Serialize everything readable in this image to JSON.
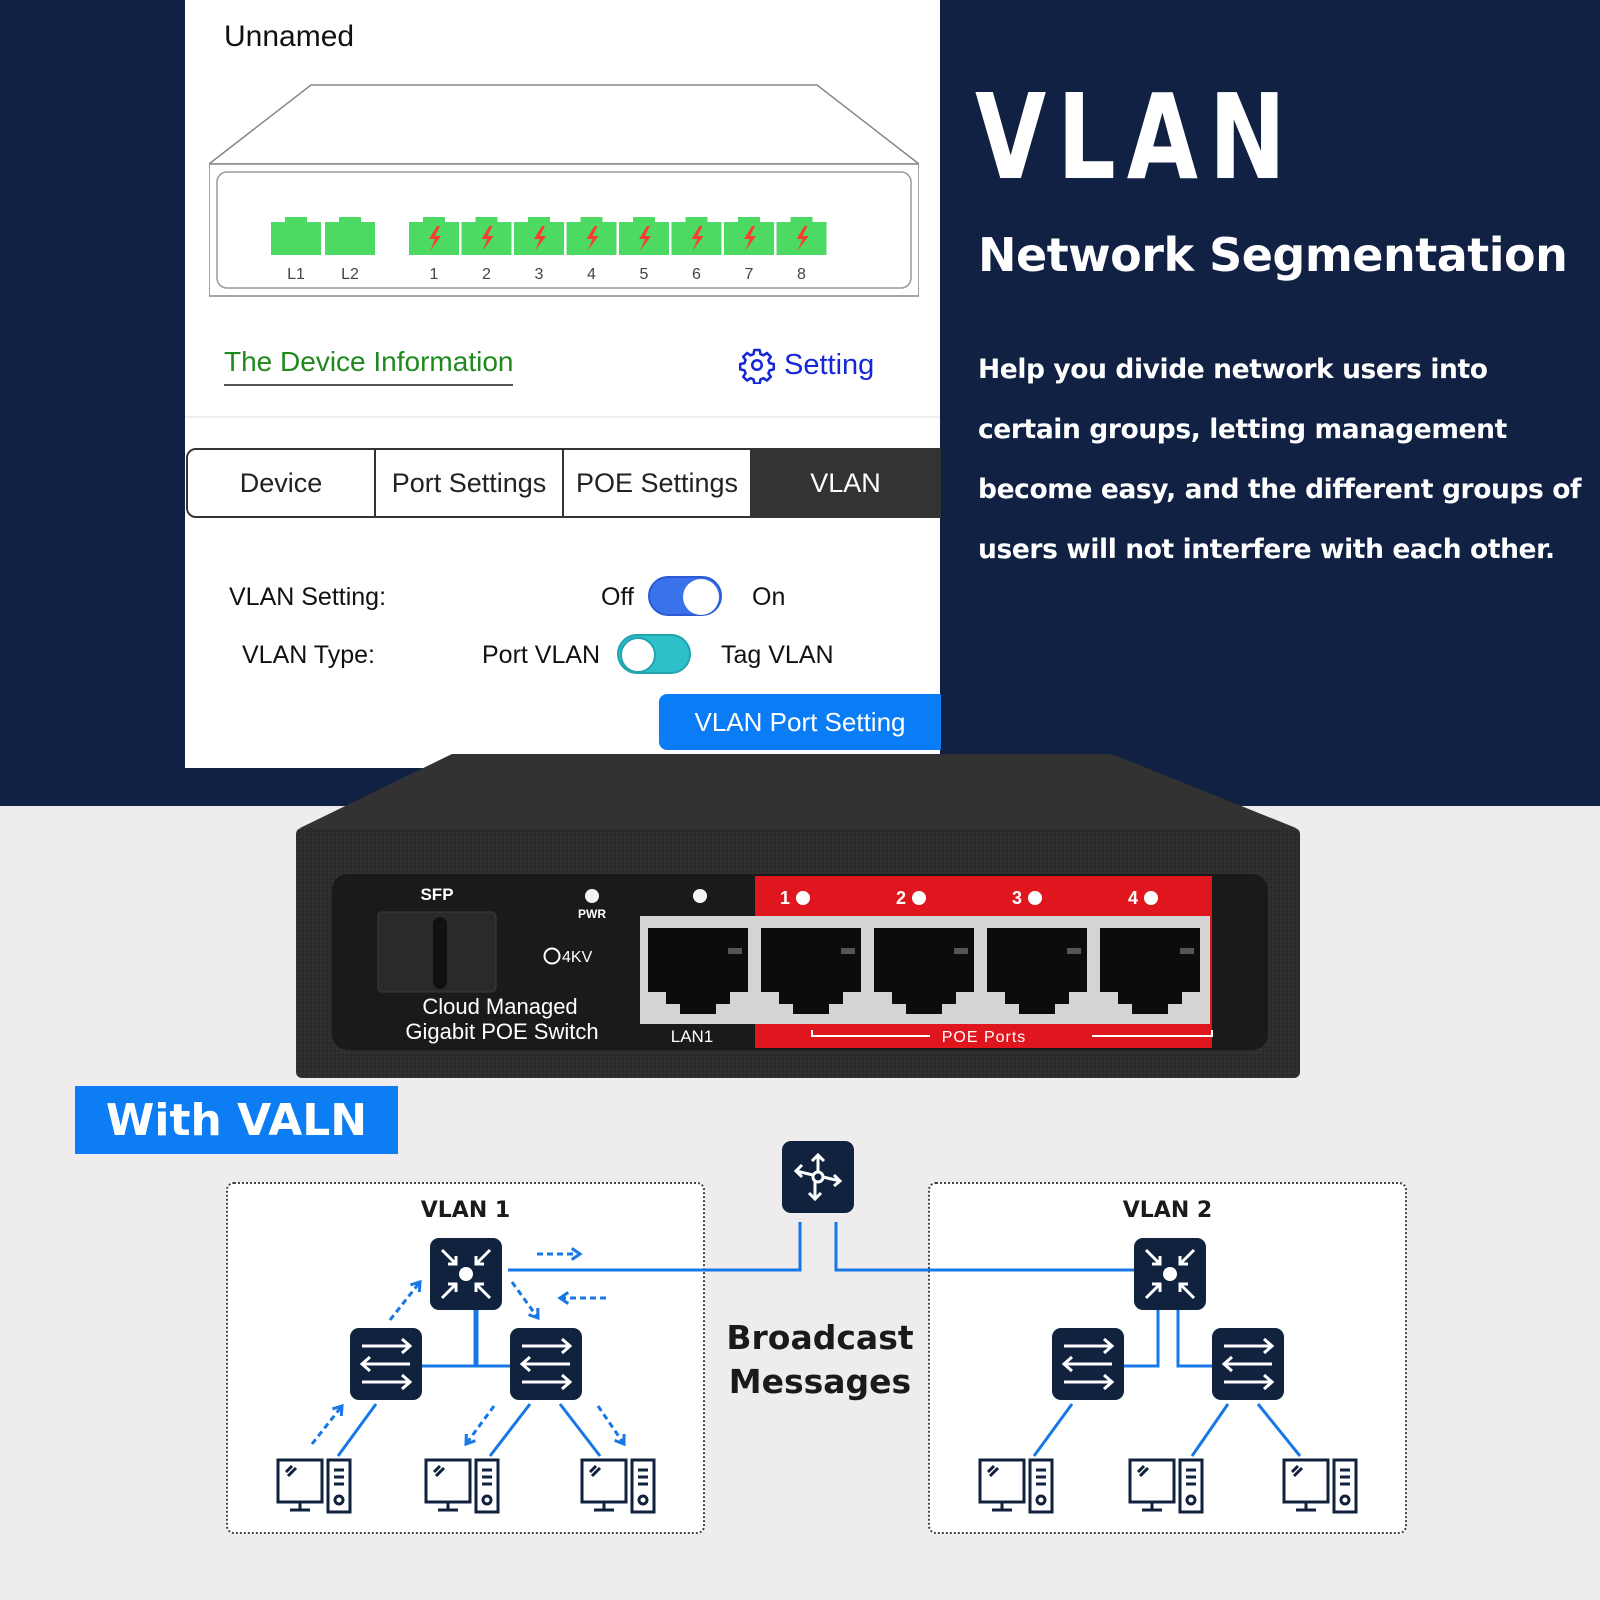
{
  "app": {
    "device_name": "Unnamed",
    "switch_diagram": {
      "lan_ports": [
        "L1",
        "L2"
      ],
      "poe_ports": [
        "1",
        "2",
        "3",
        "4",
        "5",
        "6",
        "7",
        "8"
      ],
      "port_color": "#4cd964",
      "poe_bolt_color": "#ff3b30"
    },
    "info_link": "The Device Information",
    "setting_link": "Setting",
    "tabs": [
      {
        "label": "Device",
        "active": false
      },
      {
        "label": "Port Settings",
        "active": false
      },
      {
        "label": "POE Settings",
        "active": false
      },
      {
        "label": "VLAN",
        "active": true
      }
    ],
    "vlan_setting": {
      "label": "VLAN Setting:",
      "off_label": "Off",
      "on_label": "On",
      "state": "on"
    },
    "vlan_type": {
      "label": "VLAN Type:",
      "left_label": "Port VLAN",
      "right_label": "Tag VLAN",
      "state": "Port VLAN"
    },
    "vlan_port_button": "VLAN Port Setting"
  },
  "hero": {
    "title": "VLAN",
    "subtitle": "Network Segmentation",
    "body": "Help you divide network users into certain groups, letting management become easy, and the different groups of users will not interfere with each other."
  },
  "hardware": {
    "sfp_label": "SFP",
    "pwr_label": "PWR",
    "surge_label": "4KV",
    "product_line1": "Cloud Managed",
    "product_line2": "Gigabit POE Switch",
    "lan_label": "LAN1",
    "poe_port_labels": [
      "1",
      "2",
      "3",
      "4"
    ],
    "poe_ports_label": "POE Ports",
    "accent_color": "#e0161e"
  },
  "diagram": {
    "banner": "With VALN",
    "vlan1_title": "VLAN 1",
    "vlan2_title": "VLAN 2",
    "broadcast_line1": "Broadcast",
    "broadcast_line2": "Messages",
    "node_color": "#11223f",
    "link_color": "#1677e6"
  },
  "colors": {
    "background_dark": "#112144",
    "background_light": "#eeeced",
    "primary_blue": "#0a7cf5"
  }
}
